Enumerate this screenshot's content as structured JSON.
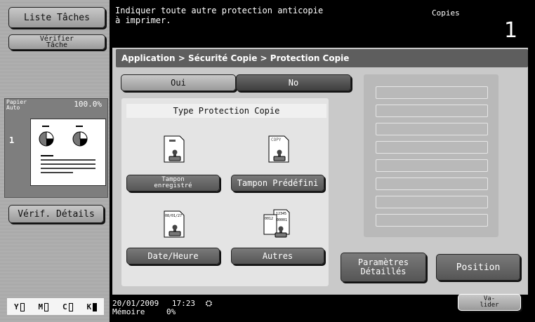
{
  "left": {
    "job_list_label": "Liste Tâches",
    "check_job_label_line1": "Vérifier",
    "check_job_label_line2": "Tâche",
    "paper_label_line1": "Papier",
    "paper_label_line2": "Auto",
    "zoom": "100.0%",
    "page_count": "1",
    "check_details_label": "Vérif. Détails"
  },
  "message": {
    "line1": "Indiquer toute autre protection anticopie",
    "line2": "à imprimer.",
    "mode": "Copies",
    "count": "1"
  },
  "breadcrumb": "Application > Sécurité Copie > Protection Copie",
  "toggle": {
    "yes": "Oui",
    "no": "No"
  },
  "section_title": "Type Protection Copie",
  "options": {
    "registered_stamp_line1": "Tampon",
    "registered_stamp_line2": "enregistré",
    "preset_stamp": "Tampon Prédéfini",
    "date_time": "Date/Heure",
    "others": "Autres"
  },
  "icon_text": {
    "copy": "COPY",
    "date": "08/01/27",
    "numbers_a": "12345",
    "numbers_b": "0012",
    "numbers_c": "00001"
  },
  "buttons": {
    "detail_settings_line1": "Paramètres",
    "detail_settings_line2": "Détaillés",
    "position": "Position",
    "validate_line1": "Va-",
    "validate_line2": "lider"
  },
  "status": {
    "date": "20/01/2009",
    "time": "17:23",
    "memory_label": "Mémoire",
    "memory_value": "0%"
  },
  "toner": {
    "y": "Y",
    "m": "M",
    "c": "C",
    "k": "K"
  }
}
